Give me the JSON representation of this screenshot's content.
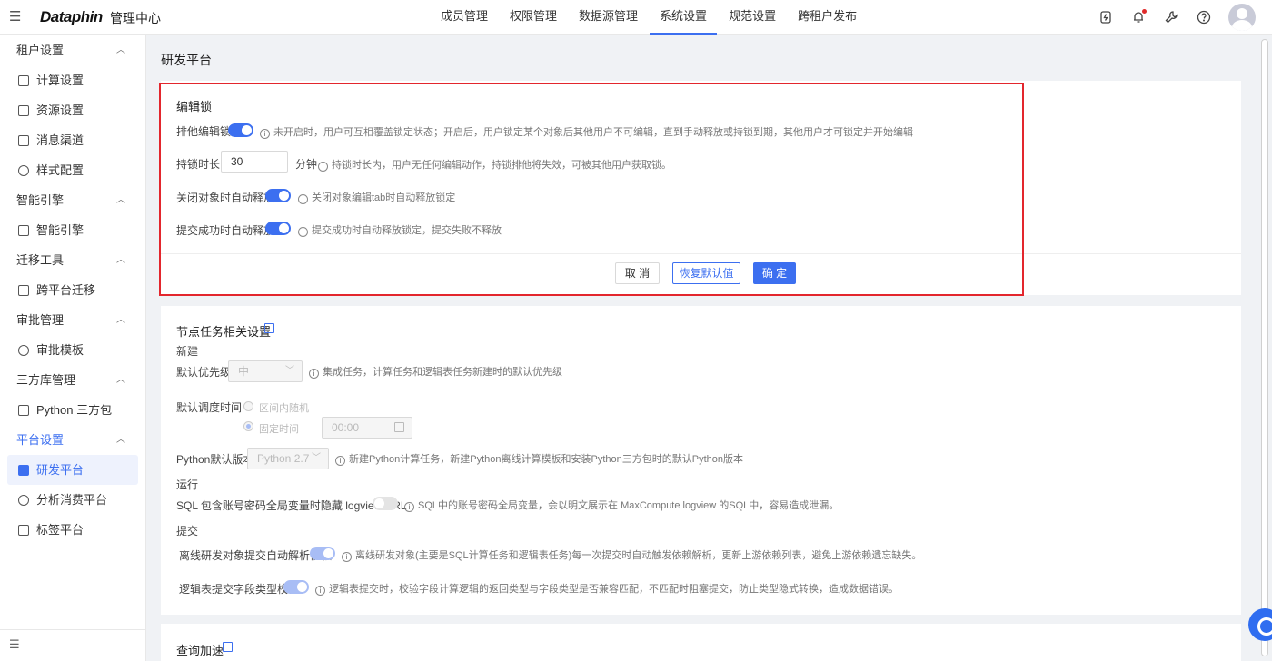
{
  "app": {
    "logo": "Dataphin",
    "subtitle": "管理中心"
  },
  "topnav": [
    "成员管理",
    "权限管理",
    "数据源管理",
    "系统设置",
    "规范设置",
    "跨租户发布"
  ],
  "sidebar": {
    "groups": [
      {
        "label": "租户设置",
        "items": [
          "计算设置",
          "资源设置",
          "消息渠道",
          "样式配置"
        ]
      },
      {
        "label": "智能引擎",
        "items": [
          "智能引擎"
        ]
      },
      {
        "label": "迁移工具",
        "items": [
          "跨平台迁移"
        ]
      },
      {
        "label": "审批管理",
        "items": [
          "审批模板"
        ]
      },
      {
        "label": "三方库管理",
        "items": [
          "Python 三方包"
        ]
      },
      {
        "label": "平台设置",
        "items": [
          "研发平台",
          "分析消费平台",
          "标签平台"
        ]
      }
    ],
    "active_item": "研发平台"
  },
  "page": {
    "title": "研发平台"
  },
  "edit_lock": {
    "title": "编辑锁",
    "exclusive_label": "排他编辑锁",
    "exclusive_desc": "未开启时，用户可互相覆盖锁定状态；开启后，用户锁定某个对象后其他用户不可编辑，直到手动释放或持锁到期，其他用户才可锁定并开始编辑",
    "duration_label": "持锁时长",
    "duration_value": "30",
    "duration_unit": "分钟",
    "duration_desc": "持锁时长内，用户无任何编辑动作，持锁排他将失效，可被其他用户获取锁。",
    "close_release_label": "关闭对象时自动释放",
    "close_release_desc": "关闭对象编辑tab时自动释放锁定",
    "submit_release_label": "提交成功时自动释放",
    "submit_release_desc": "提交成功时自动释放锁定，提交失败不释放",
    "btn_cancel": "取 消",
    "btn_restore": "恢复默认值",
    "btn_ok": "确 定"
  },
  "node_task": {
    "title": "节点任务相关设置",
    "new_section": "新建",
    "priority_label": "默认优先级",
    "priority_value": "中",
    "priority_desc": "集成任务，计算任务和逻辑表任务新建时的默认优先级",
    "schedule_label": "默认调度时间",
    "schedule_option1": "区间内随机",
    "schedule_option2": "固定时间",
    "schedule_time": "00:00",
    "python_label": "Python默认版本",
    "python_value": "Python 2.7",
    "python_desc": "新建Python计算任务，新建Python离线计算模板和安装Python三方包时的默认Python版本",
    "run_section": "运行",
    "sql_label": "SQL 包含账号密码全局变量时隐藏 logview URL",
    "sql_desc": "SQL中的账号密码全局变量，会以明文展示在 MaxCompute logview 的SQL中，容易造成泄漏。",
    "submit_section": "提交",
    "offline_label": "离线研发对象提交自动解析依赖",
    "offline_desc": "离线研发对象(主要是SQL计算任务和逻辑表任务)每一次提交时自动触发依赖解析，更新上游依赖列表，避免上游依赖遗忘缺失。",
    "logic_label": "逻辑表提交字段类型校验",
    "logic_desc": "逻辑表提交时，校验字段计算逻辑的返回类型与字段类型是否兼容匹配，不匹配时阻塞提交，防止类型隐式转换，造成数据错误。"
  },
  "query_accel": {
    "title": "查询加速"
  },
  "colors": {
    "accent": "#3c6ff0",
    "highlight_border": "#e3262d"
  }
}
